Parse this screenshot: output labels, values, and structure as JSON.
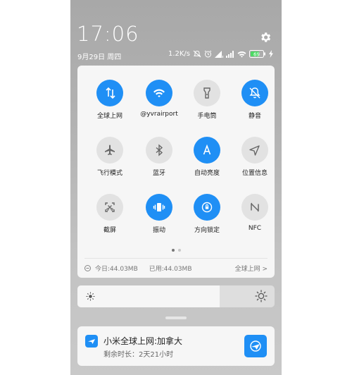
{
  "status_bar": {
    "time": "17:06",
    "date": "9月29日 周四",
    "net_speed": "1.2K/s",
    "battery": "69",
    "icons": [
      "mute-icon",
      "alarm-icon",
      "wifi-signal-icon",
      "cell-signal-icon",
      "wifi-icon",
      "battery-icon",
      "charging-icon"
    ]
  },
  "quick_settings": {
    "tiles": [
      {
        "label": "全球上网",
        "icon": "updown-arrows-icon",
        "active": true
      },
      {
        "label": "@yvrairport",
        "icon": "wifi-icon",
        "active": true
      },
      {
        "label": "手电筒",
        "icon": "flashlight-icon",
        "active": false
      },
      {
        "label": "静音",
        "icon": "bell-mute-icon",
        "active": true
      },
      {
        "label": "飞行模式",
        "icon": "airplane-icon",
        "active": false
      },
      {
        "label": "蓝牙",
        "icon": "bluetooth-icon",
        "active": false
      },
      {
        "label": "自动亮度",
        "icon": "auto-brightness-icon",
        "active": true
      },
      {
        "label": "位置信息",
        "icon": "location-icon",
        "active": false
      },
      {
        "label": "截屏",
        "icon": "screenshot-icon",
        "active": false
      },
      {
        "label": "振动",
        "icon": "vibrate-icon",
        "active": true
      },
      {
        "label": "方向锁定",
        "icon": "rotation-lock-icon",
        "active": true
      },
      {
        "label": "NFC",
        "icon": "nfc-icon",
        "active": false
      }
    ],
    "page_count": 2,
    "current_page": 1,
    "data_usage": {
      "today": "今日:44.03MB",
      "used": "已用:44.03MB",
      "link": "全球上网 >"
    }
  },
  "brightness": {
    "level": 0.72
  },
  "notification": {
    "title": "小米全球上网:加拿大",
    "subtitle": "剩余时长：2天21小时"
  },
  "colors": {
    "accent": "#1f8ff5"
  }
}
